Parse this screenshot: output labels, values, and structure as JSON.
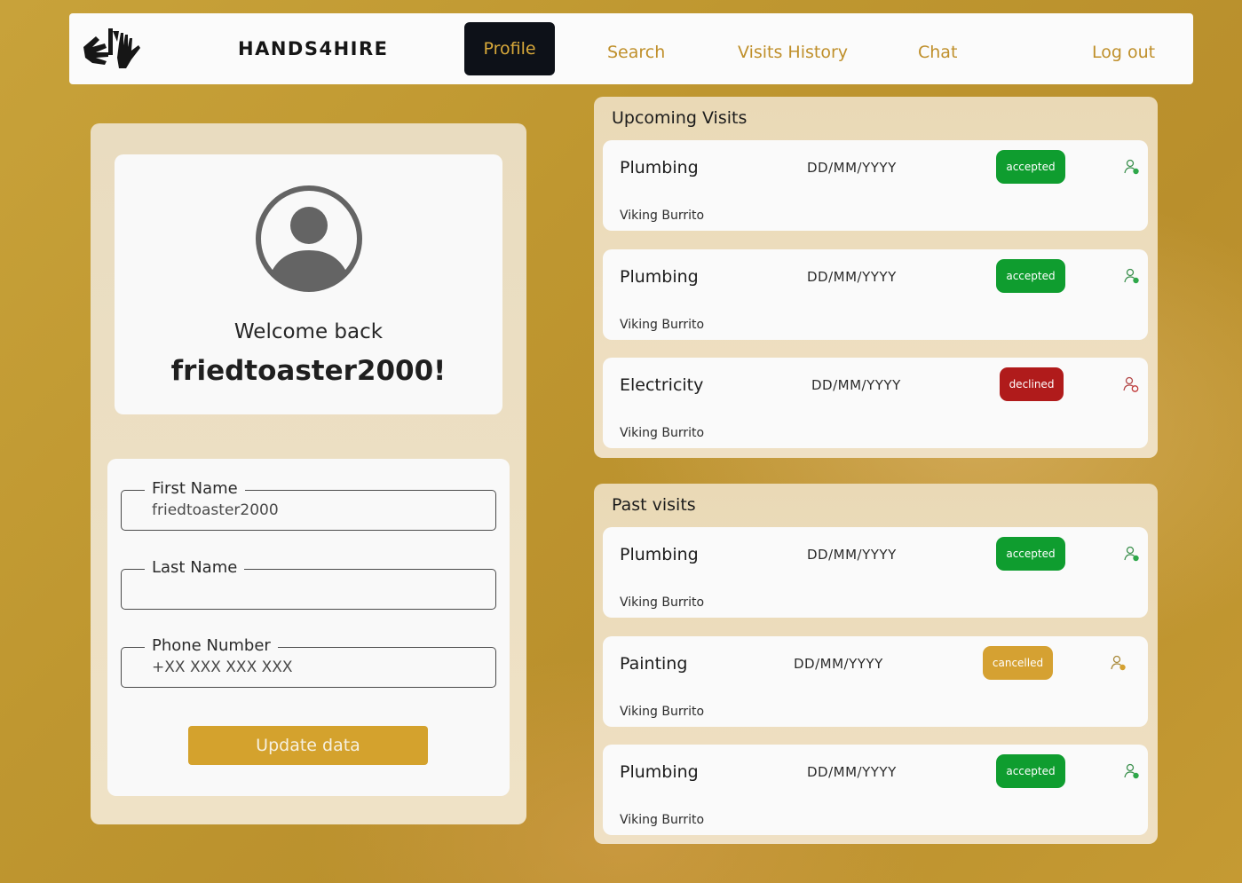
{
  "navbar": {
    "brand": "HANDS4HIRE",
    "logo_icon": "hands-logo-icon",
    "items": [
      {
        "label": "Profile",
        "active": true
      },
      {
        "label": "Search"
      },
      {
        "label": "Visits History"
      },
      {
        "label": "Chat"
      },
      {
        "label": "Log out"
      }
    ]
  },
  "profile": {
    "avatar_icon": "user-avatar-icon",
    "welcome": "Welcome  back",
    "username": "friedtoaster2000!",
    "form": {
      "first_name": {
        "label": "First Name",
        "value": "friedtoaster2000"
      },
      "last_name": {
        "label": "Last Name",
        "value": ""
      },
      "phone": {
        "label": "Phone Number",
        "placeholder": "+XX XXX XXX XXX"
      },
      "update_button": "Update data"
    }
  },
  "upcoming": {
    "title": "Upcoming Visits",
    "visits": [
      {
        "service": "Plumbing",
        "date": "DD/MM/YYYY",
        "status": "accepted",
        "client": "Viking Burrito"
      },
      {
        "service": "Plumbing",
        "date": "DD/MM/YYYY",
        "status": "accepted",
        "client": "Viking Burrito"
      },
      {
        "service": "Electricity",
        "date": "DD/MM/YYYY",
        "status": "declined",
        "client": "Viking Burrito"
      }
    ]
  },
  "past": {
    "title": "Past visits",
    "visits": [
      {
        "service": "Plumbing",
        "date": "DD/MM/YYYY",
        "status": "accepted",
        "client": "Viking Burrito"
      },
      {
        "service": "Painting",
        "date": "DD/MM/YYYY",
        "status": "cancelled",
        "client": "Viking Burrito"
      },
      {
        "service": "Plumbing",
        "date": "DD/MM/YYYY",
        "status": "accepted",
        "client": "Viking Burrito"
      }
    ]
  },
  "colors": {
    "accent_gold": "#d4a22d",
    "nav_active_bg": "#0d1118",
    "accepted": "#0f9d2f",
    "declined": "#b01b1b",
    "cancelled": "#d5a132"
  }
}
